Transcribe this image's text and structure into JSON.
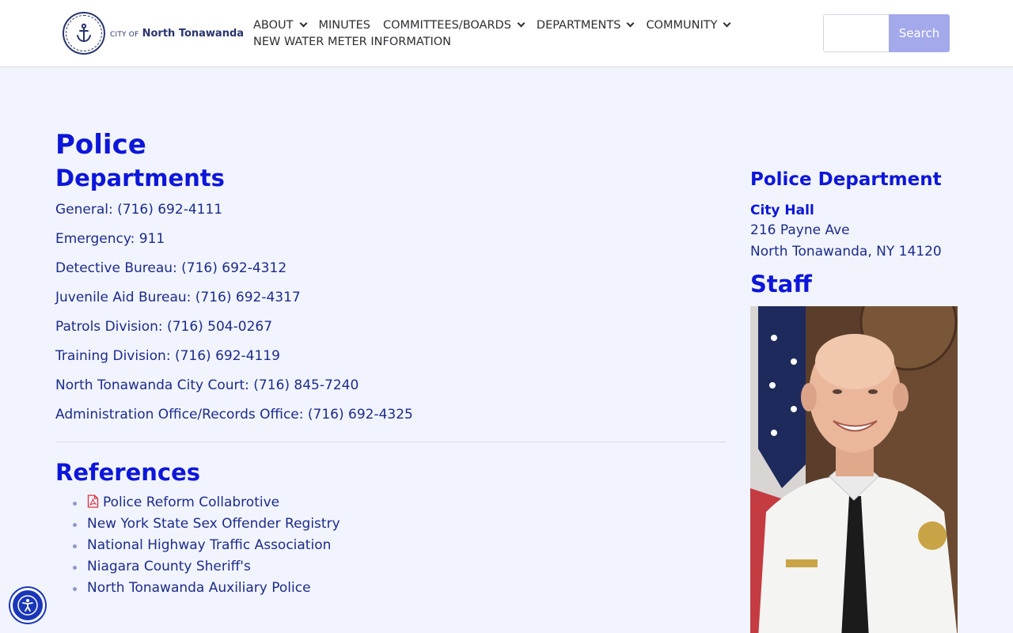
{
  "header": {
    "logo": {
      "small": "CITY OF",
      "name": "North Tonawanda"
    },
    "nav": [
      {
        "label": "ABOUT",
        "dropdown": true
      },
      {
        "label": "MINUTES",
        "dropdown": false
      },
      {
        "label": "COMMITTEES/BOARDS",
        "dropdown": true
      },
      {
        "label": "DEPARTMENTS",
        "dropdown": true
      },
      {
        "label": "COMMUNITY",
        "dropdown": true
      },
      {
        "label": "NEW WATER METER INFORMATION",
        "dropdown": false
      }
    ],
    "search": {
      "placeholder": "",
      "button_label": "Search"
    }
  },
  "main": {
    "title": "Police",
    "departments_title": "Departments",
    "contacts": [
      "General: (716) 692-4111",
      "Emergency: 911",
      "Detective Bureau: (716) 692-4312",
      "Juvenile Aid Bureau: (716) 692-4317",
      "Patrols Division: (716) 504-0267",
      "Training Division: (716) 692-4119",
      "North Tonawanda City Court: (716) 845-7240",
      "Administration Office/Records Office: (716) 692-4325"
    ],
    "references_title": "References",
    "references": [
      {
        "label": "Police Reform Collabrotive",
        "icon": "pdf-icon"
      },
      {
        "label": "New York State Sex Offender Registry",
        "icon": ""
      },
      {
        "label": "National Highway Traffic Association",
        "icon": ""
      },
      {
        "label": "Niagara County Sheriff's",
        "icon": ""
      },
      {
        "label": "North Tonawanda Auxiliary Police",
        "icon": ""
      }
    ]
  },
  "sidebar": {
    "title": "Police Department",
    "location": "City Hall",
    "address1": "216 Payne Ave",
    "address2": "North Tonawanda, NY 14120",
    "staff_title": "Staff"
  },
  "colors": {
    "heading": "#0d16d9",
    "link": "#1c2b8c",
    "background": "#f1f4fc",
    "search_button": "#a3a9ea",
    "accessibility": "#1a37b8"
  }
}
